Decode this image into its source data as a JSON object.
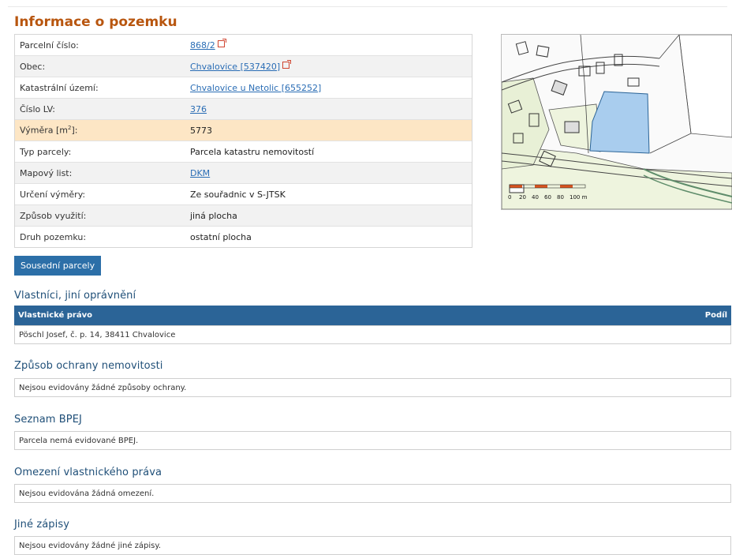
{
  "title": "Informace o pozemku",
  "rows": [
    {
      "label": "Parcelní číslo:",
      "value": "868/2",
      "link": true,
      "ext": true
    },
    {
      "label": "Obec:",
      "value": "Chvalovice [537420]",
      "link": true,
      "ext": true
    },
    {
      "label": "Katastrální území:",
      "value": "Chvalovice u Netolic [655252]",
      "link": true
    },
    {
      "label": "Číslo LV:",
      "value": "376",
      "link": true
    },
    {
      "label_prefix": "Výměra [m",
      "label_sup": "2",
      "label_suffix": "]:",
      "value": "5773",
      "highlight": true
    },
    {
      "label": "Typ parcely:",
      "value": "Parcela katastru nemovitostí"
    },
    {
      "label": "Mapový list:",
      "value": "DKM",
      "link": true
    },
    {
      "label": "Určení výměry:",
      "value": "Ze souřadnic v S-JTSK"
    },
    {
      "label": "Způsob využití:",
      "value": "jiná plocha"
    },
    {
      "label": "Druh pozemku:",
      "value": "ostatní plocha"
    }
  ],
  "map": {
    "scale_labels": [
      "0",
      "20",
      "40",
      "60",
      "80",
      "100 m"
    ],
    "highlight_color": "#a9cdee"
  },
  "neighbors_button": "Sousední parcely",
  "owners": {
    "heading": "Vlastníci, jiní oprávnění",
    "col_right": "Vlastnické právo",
    "col_share": "Podíl",
    "entry": "Pöschl Josef, č. p. 14, 38411 Chvalovice"
  },
  "protection": {
    "heading": "Způsob ochrany nemovitosti",
    "text": "Nejsou evidovány žádné způsoby ochrany."
  },
  "bpej": {
    "heading": "Seznam BPEJ",
    "text": "Parcela nemá evidované BPEJ."
  },
  "restrictions": {
    "heading": "Omezení vlastnického práva",
    "text": "Nejsou evidována žádná omezení."
  },
  "other": {
    "heading": "Jiné zápisy",
    "text": "Nejsou evidovány žádné jiné zápisy."
  }
}
